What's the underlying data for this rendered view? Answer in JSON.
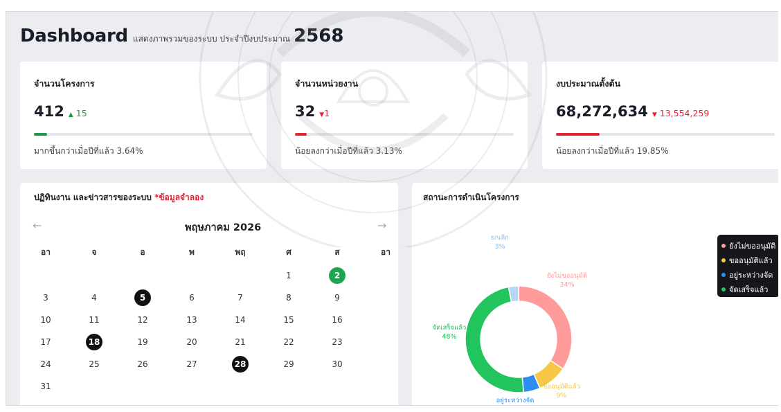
{
  "header": {
    "title": "Dashboard",
    "subtitle": "แสดงภาพรวมของระบบ ประจำปีงบประมาณ",
    "year": "2568"
  },
  "stats": [
    {
      "label": "จำนวนโครงการ",
      "value": "412",
      "delta_arrow": "▲",
      "delta": "15",
      "direction": "up",
      "note": "มากขึ้นกว่าเมื่อปีที่แล้ว 3.64%",
      "color": "#1c9b47",
      "progress_percent": 3.64
    },
    {
      "label": "จำนวนหน่วยงาน",
      "value": "32",
      "delta_arrow": "▼",
      "delta": "1",
      "direction": "down",
      "note": "น้อยลงกว่าเมื่อปีที่แล้ว 3.13%",
      "color": "#e32636",
      "progress_percent": 3.13
    },
    {
      "label": "งบประมาณตั้งต้น",
      "value": "68,272,634",
      "delta_arrow": "▼",
      "delta": "13,554,259",
      "direction": "down",
      "note": "น้อยลงกว่าเมื่อปีที่แล้ว 19.85%",
      "color": "#e32636",
      "progress_percent": 19.85
    }
  ],
  "calendar_panel": {
    "title": "ปฏิทินงาน และข่าวสารของระบบ",
    "title_note": "*ข้อมูลจำลอง",
    "prev_icon": "←",
    "next_icon": "→",
    "month_label": "พฤษภาคม 2026",
    "weekdays": [
      "อา",
      "จ",
      "อ",
      "พ",
      "พฤ",
      "ศ",
      "ส",
      "อา"
    ],
    "weeks": [
      [
        "",
        "",
        "",
        "",
        "",
        "1",
        "2"
      ],
      [
        "3",
        "4",
        "5",
        "6",
        "7",
        "8",
        "9"
      ],
      [
        "10",
        "11",
        "12",
        "13",
        "14",
        "15",
        "16"
      ],
      [
        "17",
        "18",
        "19",
        "20",
        "21",
        "22",
        "23"
      ],
      [
        "24",
        "25",
        "26",
        "27",
        "28",
        "29",
        "30"
      ],
      [
        "31",
        "",
        "",
        "",
        "",
        "",
        ""
      ]
    ],
    "highlighted_black": [
      "5",
      "18",
      "28"
    ],
    "highlighted_green": [
      "2"
    ]
  },
  "status_panel": {
    "title": "สถานะการดำเนินโครงการ",
    "legend": [
      {
        "label": "ยังไม่ขออนุมัติ",
        "color": "#ff9b9b"
      },
      {
        "label": "ขออนุมัติแล้ว",
        "color": "#f6c744"
      },
      {
        "label": "อยู่ระหว่างจัด",
        "color": "#2f8cf0"
      },
      {
        "label": "จัดเสร็จแล้ว",
        "color": "#22c45e"
      }
    ]
  },
  "chart_data": {
    "type": "pie",
    "donut": true,
    "title": "สถานะการดำเนินโครงการ",
    "slices": [
      {
        "name": "ยังไม่ขออนุมัติ",
        "value": 34,
        "label": "34%",
        "color": "#ff9b9b"
      },
      {
        "name": "ขออนุมัติแล้ว",
        "value": 9,
        "label": "9%",
        "color": "#f6c744"
      },
      {
        "name": "อยู่ระหว่างจัด",
        "value": 5,
        "label": "5%",
        "color": "#2f8cf0"
      },
      {
        "name": "จัดเสร็จแล้ว",
        "value": 48,
        "label": "48%",
        "color": "#22c45e"
      },
      {
        "name": "ยกเลิก",
        "value": 3,
        "label": "3%",
        "color": "#b5d6f5"
      }
    ],
    "legend_position": "top-right"
  }
}
